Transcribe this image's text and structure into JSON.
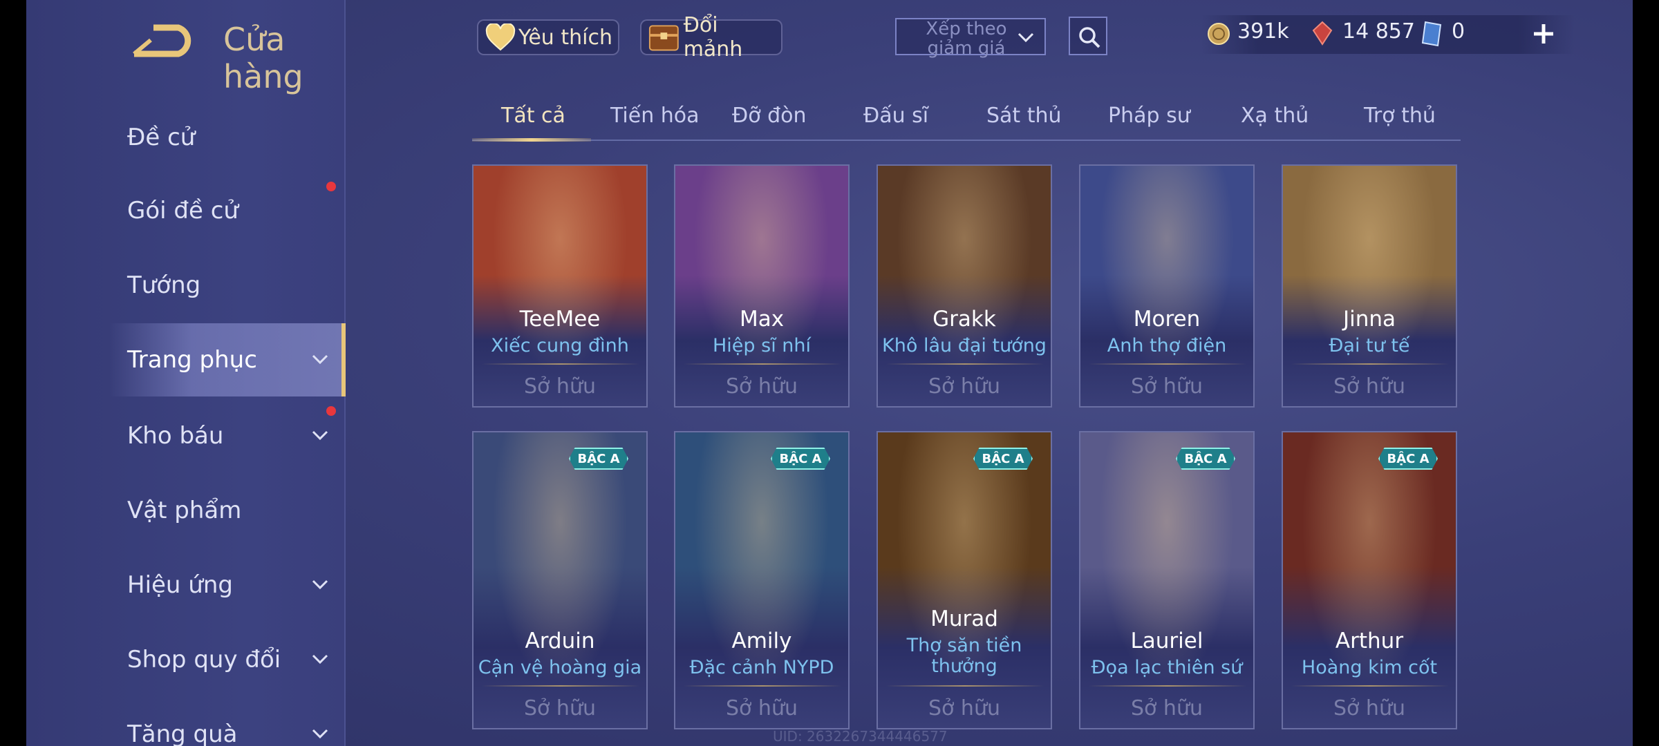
{
  "header": {
    "title": "Cửa hàng"
  },
  "sidebar": {
    "items": [
      {
        "label": "Đề cử"
      },
      {
        "label": "Gói đề cử"
      },
      {
        "label": "Tướng"
      },
      {
        "label": "Trang phục"
      },
      {
        "label": "Kho báu"
      },
      {
        "label": "Vật phẩm"
      },
      {
        "label": "Hiệu ứng"
      },
      {
        "label": "Shop quy đổi"
      },
      {
        "label": "Tăng quà"
      }
    ]
  },
  "topbar": {
    "favorite_label": "Yêu thích",
    "exchange_label": "Đổi mảnh",
    "sort_label": "Xếp theo giảm giá",
    "gold": "391k",
    "rubies": "14 857",
    "vouchers": "0"
  },
  "tabs": [
    {
      "label": "Tất cả"
    },
    {
      "label": "Tiến hóa"
    },
    {
      "label": "Đỡ đòn"
    },
    {
      "label": "Đấu sĩ"
    },
    {
      "label": "Sát thủ"
    },
    {
      "label": "Pháp sư"
    },
    {
      "label": "Xạ thủ"
    },
    {
      "label": "Trợ thủ"
    }
  ],
  "cards": [
    {
      "hero": "TeeMee",
      "skin": "Xiếc cung đình",
      "status": "Sở hữu",
      "color": "#a0402c"
    },
    {
      "hero": "Max",
      "skin": "Hiệp sĩ nhí",
      "status": "Sở hữu",
      "color": "#6b3f8a"
    },
    {
      "hero": "Grakk",
      "skin": "Khô lâu đại tướng",
      "status": "Sở hữu",
      "color": "#5a3a26"
    },
    {
      "hero": "Moren",
      "skin": "Anh thợ điện",
      "status": "Sở hữu",
      "color": "#3d4a8a"
    },
    {
      "hero": "Jinna",
      "skin": "Đại tư tế",
      "status": "Sở hữu",
      "color": "#8a6a40"
    },
    {
      "hero": "Arduin",
      "skin": "Cận vệ hoàng gia",
      "status": "Sở hữu",
      "color": "#3a4a78",
      "badge": "BẬC A"
    },
    {
      "hero": "Amily",
      "skin": "Đặc cảnh NYPD",
      "status": "Sở hữu",
      "color": "#2e4f7a",
      "badge": "BẬC A"
    },
    {
      "hero": "Murad",
      "skin": "Thợ săn tiền thưởng",
      "status": "Sở hữu",
      "color": "#5a3a1c",
      "badge": "BẬC A"
    },
    {
      "hero": "Lauriel",
      "skin": "Đọa lạc thiên sứ",
      "status": "Sở hữu",
      "color": "#5a5a8a",
      "badge": "BẬC A"
    },
    {
      "hero": "Arthur",
      "skin": "Hoàng kim cốt",
      "status": "Sở hữu",
      "color": "#6a2a22",
      "badge": "BẬC A"
    }
  ],
  "footer": {
    "uid": "UID: 2632267344446577"
  }
}
